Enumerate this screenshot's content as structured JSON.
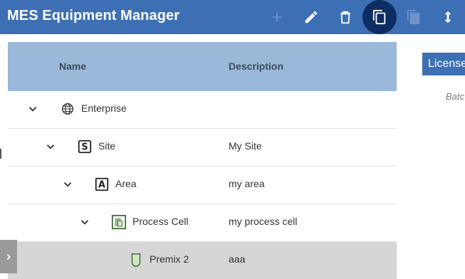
{
  "app": {
    "title": "MES Equipment Manager",
    "accent": "#3d6fb4",
    "active_tool_bg": "#0d2d63"
  },
  "toolbar": [
    {
      "icon": "plus-icon",
      "enabled": false
    },
    {
      "icon": "pencil-icon",
      "enabled": true
    },
    {
      "icon": "trash-icon",
      "enabled": true
    },
    {
      "icon": "copy-icon",
      "enabled": true,
      "active": true
    },
    {
      "icon": "paste-icon",
      "enabled": false
    },
    {
      "icon": "move-vertical-icon",
      "enabled": true
    }
  ],
  "tree": {
    "columns": {
      "name": "Name",
      "description": "Description"
    },
    "rows": [
      {
        "name": "Enterprise",
        "description": "",
        "icon": "globe-icon",
        "expanded": true,
        "level": 0
      },
      {
        "name": "Site",
        "description": "My Site",
        "icon": "site-s-icon",
        "expanded": true,
        "level": 1
      },
      {
        "name": "Area",
        "description": "my area",
        "icon": "area-a-icon",
        "expanded": true,
        "level": 2
      },
      {
        "name": "Process Cell",
        "description": "my process cell",
        "icon": "process-cell-icon",
        "expanded": true,
        "level": 3
      },
      {
        "name": "Premix 2",
        "description": "aaa",
        "icon": "unit-icon",
        "expanded": false,
        "level": 4,
        "selected": true
      }
    ]
  },
  "right_panel": {
    "license_button": "License",
    "batch_text": "Batc"
  }
}
